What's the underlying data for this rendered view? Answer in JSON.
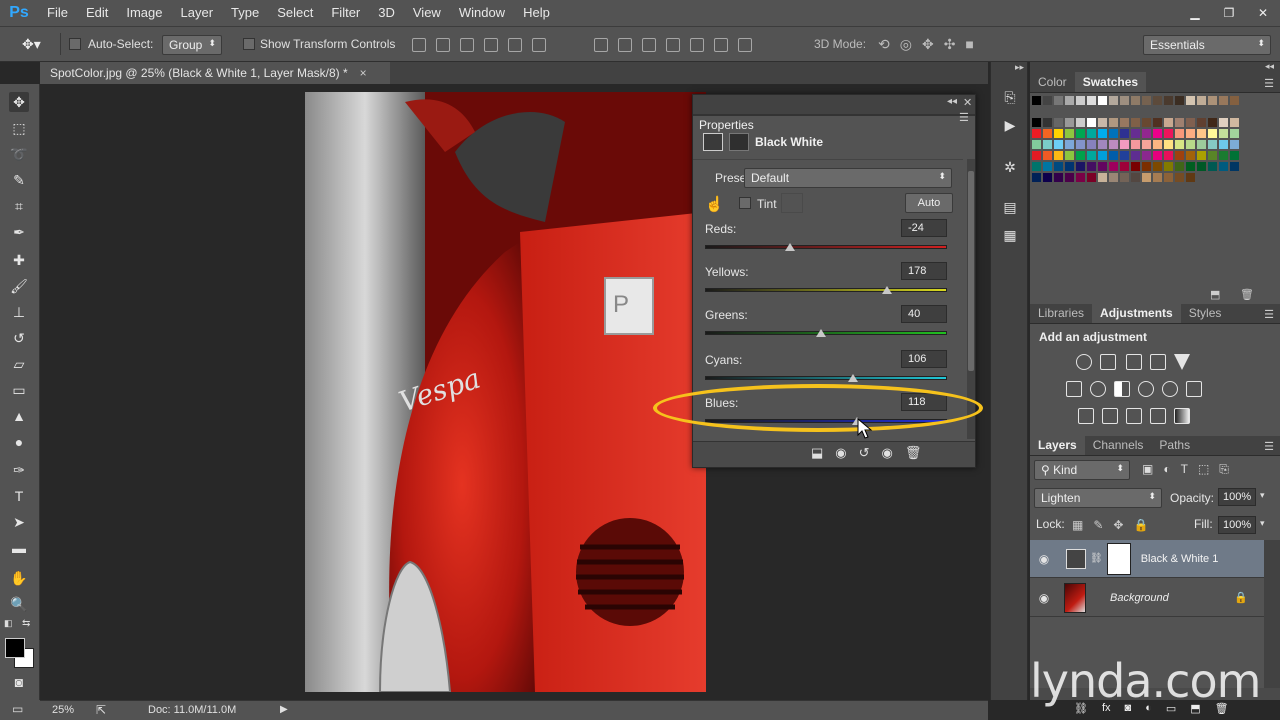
{
  "app": {
    "logo": "Ps"
  },
  "menubar": {
    "items": [
      "File",
      "Edit",
      "Image",
      "Layer",
      "Type",
      "Select",
      "Filter",
      "3D",
      "View",
      "Window",
      "Help"
    ]
  },
  "options": {
    "auto_select_label": "Auto-Select:",
    "auto_select_value": "Group",
    "transform_controls_label": "Show Transform Controls",
    "mode_3d_label": "3D Mode:",
    "workspace": "Essentials"
  },
  "document": {
    "tab_title": "SpotColor.jpg @ 25% (Black & White 1, Layer Mask/8) *",
    "close": "×"
  },
  "status": {
    "zoom": "25%",
    "doc_info": "Doc: 11.0M/11.0M"
  },
  "properties": {
    "title": "Properties",
    "adjustment_name": "Black White",
    "preset_label": "Preset:",
    "preset_value": "Default",
    "tint_label": "Tint",
    "auto_label": "Auto",
    "sliders": [
      {
        "label": "Reds:",
        "value": "-24",
        "position": 0.35
      },
      {
        "label": "Yellows:",
        "value": "178",
        "position": 0.75
      },
      {
        "label": "Greens:",
        "value": "40",
        "position": 0.48
      },
      {
        "label": "Cyans:",
        "value": "106",
        "position": 0.61
      },
      {
        "label": "Blues:",
        "value": "118",
        "position": 0.63
      }
    ]
  },
  "swatch_panel": {
    "tabs": [
      "Color",
      "Swatches"
    ],
    "active": "Swatches"
  },
  "adjustments_panel": {
    "tabs": [
      "Libraries",
      "Adjustments",
      "Styles"
    ],
    "active": "Adjustments",
    "heading": "Add an adjustment"
  },
  "layers_panel": {
    "tabs": [
      "Layers",
      "Channels",
      "Paths"
    ],
    "active": "Layers",
    "filter": "Kind",
    "blend_mode": "Lighten",
    "opacity_label": "Opacity:",
    "opacity_value": "100%",
    "lock_label": "Lock:",
    "fill_label": "Fill:",
    "fill_value": "100%",
    "layers": [
      {
        "name": "Black & White 1",
        "selected": true
      },
      {
        "name": "Background",
        "selected": false
      }
    ]
  },
  "watermark": "lynda.com",
  "colors": {
    "accent": "#f6c21c",
    "ps_blue": "#31a8ff",
    "ui_gray": "#535353"
  }
}
